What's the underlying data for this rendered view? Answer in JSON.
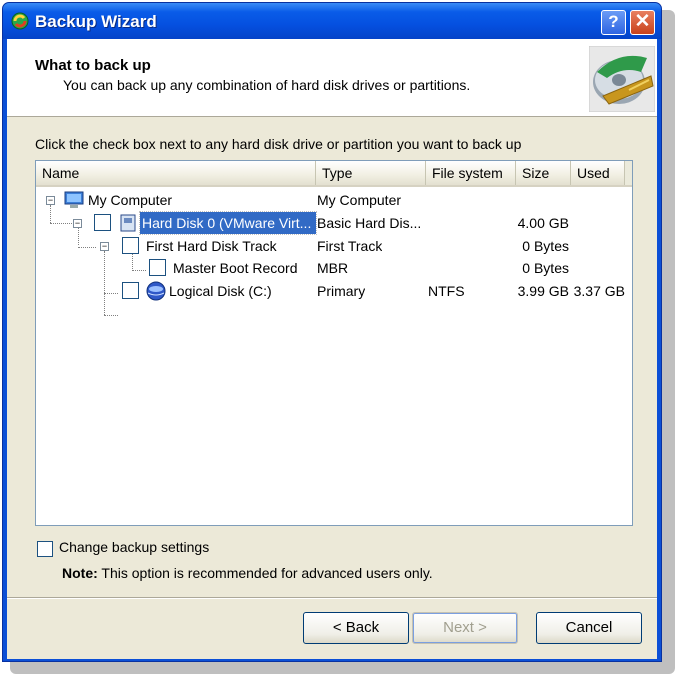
{
  "window": {
    "title": "Backup Wizard",
    "help_label": "?",
    "close_label": "✕"
  },
  "header": {
    "title": "What to back up",
    "subtitle": "You can back up any combination of hard disk drives or partitions."
  },
  "instruction": "Click the check box next to any hard disk drive or partition you want to back up",
  "columns": [
    "Name",
    "Type",
    "File system",
    "Size",
    "Used"
  ],
  "rows": [
    {
      "name": "My Computer",
      "type": "My Computer",
      "fs": "",
      "size": "",
      "used": ""
    },
    {
      "name": "Hard Disk 0 (VMware Virt...",
      "type": "Basic Hard Dis...",
      "fs": "",
      "size": "4.00 GB",
      "used": ""
    },
    {
      "name": "First Hard Disk Track",
      "type": "First Track",
      "fs": "",
      "size": "0 Bytes",
      "used": ""
    },
    {
      "name": "Master Boot Record",
      "type": "MBR",
      "fs": "",
      "size": "0 Bytes",
      "used": ""
    },
    {
      "name": "Logical Disk (C:)",
      "type": "Primary",
      "fs": "NTFS",
      "size": "3.99 GB",
      "used": "3.37 GB"
    }
  ],
  "options": {
    "change_settings_label": "Change backup settings",
    "note_prefix": "Note:",
    "note_text": "This option is recommended for advanced users only."
  },
  "buttons": {
    "back": "< Back",
    "next": "Next >",
    "cancel": "Cancel"
  },
  "colors": {
    "titlebar": "#0a5ce8",
    "selection": "#316ac5",
    "dialog_bg": "#ece9d8"
  }
}
